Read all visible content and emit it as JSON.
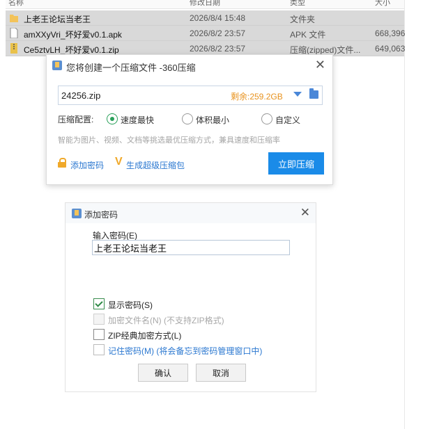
{
  "file_list": {
    "headers": [
      "名称",
      "修改日期",
      "类型",
      "大小"
    ],
    "rows": [
      {
        "name": "上老王论坛当老王",
        "date": "2026/8/4 15:48",
        "type": "文件夹",
        "size": "",
        "icon": "folder-icon",
        "color": "#f3c35a"
      },
      {
        "name": "amXXyVri_坏好爱v0.1.apk",
        "date": "2026/8/2 23:57",
        "type": "APK 文件",
        "size": "668,396",
        "icon": "file-icon",
        "color": "#ffffff"
      },
      {
        "name": "Ce5ztvLH_坏好爱v0.1.zip",
        "date": "2026/8/2 23:57",
        "type": "压缩(zipped)文件...",
        "size": "649,063",
        "icon": "zip-icon",
        "color": "#e9c14a"
      }
    ]
  },
  "compress_dialog": {
    "title": "您将创建一个压缩文件 -360压缩",
    "filename": "24256.zip",
    "free_space": "剩余:259.2GB",
    "config_label": "压缩配置:",
    "options": [
      "速度最快",
      "体积最小",
      "自定义"
    ],
    "selected_option": "速度最快",
    "hint": "智能为图片、视频、文档等挑选最优压缩方式，兼具速度和压缩率",
    "add_password": "添加密码",
    "super_package": "生成超级压缩包",
    "compress_button": "立即压缩",
    "accent_color": "#1a8be8"
  },
  "password_dialog": {
    "title": "添加密码",
    "input_label": "输入密码(E)",
    "password_value": "上老王论坛当老王",
    "checkboxes": [
      {
        "label": "显示密码(S)",
        "checked": true,
        "enabled": true
      },
      {
        "label": "加密文件名(N) (不支持ZIP格式)",
        "checked": false,
        "enabled": false
      },
      {
        "label": "ZIP经典加密方式(L)",
        "checked": false,
        "enabled": true
      },
      {
        "label": "记住密码(M) (将会备忘到密码管理窗口中)",
        "checked": false,
        "enabled": true
      }
    ],
    "ok_button": "确认",
    "cancel_button": "取消"
  }
}
